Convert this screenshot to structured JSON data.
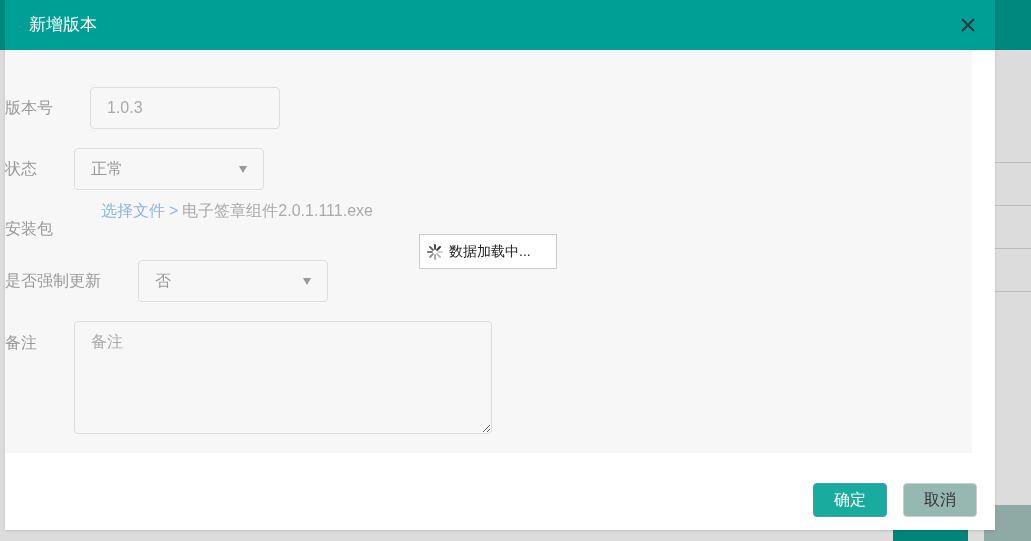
{
  "dialog": {
    "title": "新增版本",
    "fields": [
      {
        "kind": "text",
        "label": "版本号",
        "value": "1.0.3"
      },
      {
        "kind": "select",
        "label": "状态",
        "value": "正常"
      },
      {
        "kind": "file",
        "label": "安装包",
        "link": "选择文件",
        "separator": ">",
        "filename": "电子签章组件2.0.1.111.exe"
      },
      {
        "kind": "select",
        "label": "是否强制更新",
        "value": "否"
      },
      {
        "kind": "textarea",
        "label": "备注",
        "placeholder": "备注"
      }
    ],
    "loading": {
      "text": "数据加载中..."
    },
    "buttons": [
      {
        "kind": "primary",
        "label": "确定"
      },
      {
        "kind": "secondary",
        "label": "取消"
      }
    ]
  }
}
